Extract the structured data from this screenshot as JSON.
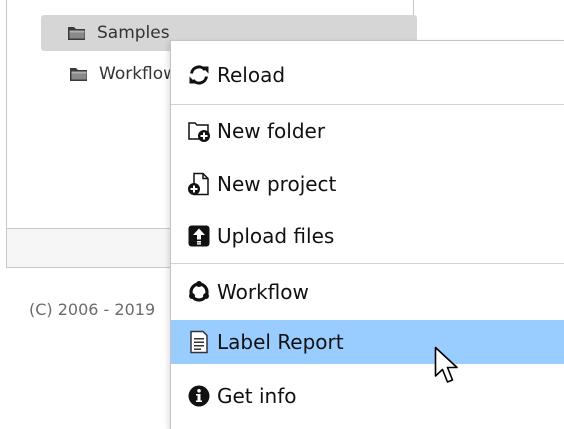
{
  "tree": {
    "items": [
      {
        "label": "Samples",
        "icon": "folder-icon",
        "selected": true
      },
      {
        "label": "Workflows",
        "icon": "folder-icon",
        "selected": false
      }
    ]
  },
  "footer": {
    "copyright": "(C) 2006 - 2019"
  },
  "context_menu": {
    "highlighted_item": "Label Report",
    "items": [
      {
        "label": "Reload",
        "icon": "reload-icon"
      },
      {
        "label": "New folder",
        "icon": "new-folder-icon"
      },
      {
        "label": "New project",
        "icon": "new-project-icon"
      },
      {
        "label": "Upload files",
        "icon": "upload-icon"
      },
      {
        "label": "Workflow",
        "icon": "workflow-icon"
      },
      {
        "label": "Label Report",
        "icon": "report-icon"
      },
      {
        "label": "Get info",
        "icon": "info-icon"
      }
    ]
  },
  "colors": {
    "menu_highlight": "#99ccff",
    "tree_selection": "#d6d6d6",
    "separator": "#d2d2d2"
  }
}
